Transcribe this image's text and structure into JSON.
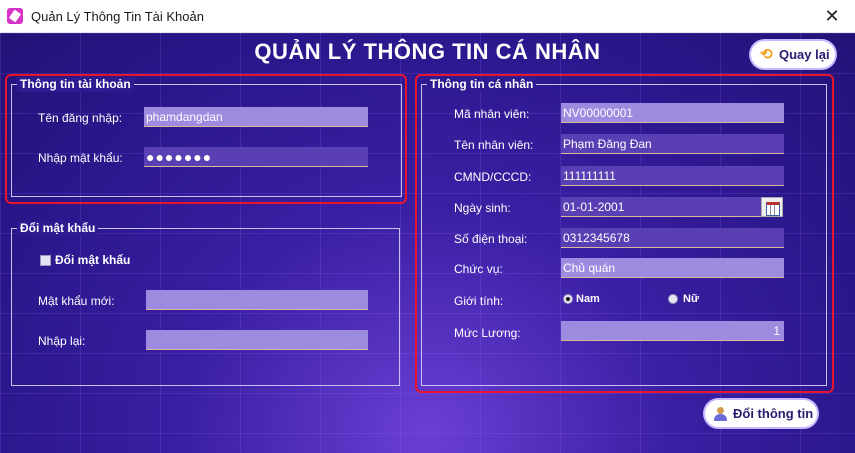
{
  "window": {
    "title": "Quản Lý Thông Tin Tài Khoản",
    "close_label": "✕"
  },
  "header": {
    "title": "QUẢN LÝ THÔNG TIN CÁ NHÂN",
    "back_button": "Quay lại"
  },
  "account": {
    "group_title": "Thông tin tài khoản",
    "username_label": "Tên đăng nhập:",
    "username_value": "phamdangdan",
    "password_label": "Nhập mật khẩu:",
    "password_value": "●●●●●●●"
  },
  "change_password": {
    "group_title": "Đổi mật khẩu",
    "checkbox_label": "Đổi mật khẩu",
    "checked": false,
    "new_password_label": "Mật khẩu mới:",
    "new_password_value": "",
    "confirm_label": "Nhập lại:",
    "confirm_value": ""
  },
  "personal": {
    "group_title": "Thông tin cá nhân",
    "employee_id_label": "Mã nhân viên:",
    "employee_id_value": "NV00000001",
    "name_label": "Tên nhân viên:",
    "name_value": "Phạm Đăng Đan",
    "id_card_label": "CMND/CCCD:",
    "id_card_value": "111111111",
    "dob_label": "Ngày sinh:",
    "dob_value": "01-01-2001",
    "phone_label": "Số điện thoại:",
    "phone_value": "0312345678",
    "position_label": "Chức vụ:",
    "position_value": "Chủ quán",
    "gender_label": "Giới tính:",
    "gender_options": [
      "Nam",
      "Nữ"
    ],
    "gender_selected": "Nam",
    "salary_label": "Mức Lương:",
    "salary_value": "1"
  },
  "footer": {
    "update_button": "Đổi thông tin"
  },
  "colors": {
    "background": "#2a168a",
    "field": "#9d8be0",
    "field_dark": "#5a3fb4",
    "highlight_frame": "#e8142a"
  }
}
